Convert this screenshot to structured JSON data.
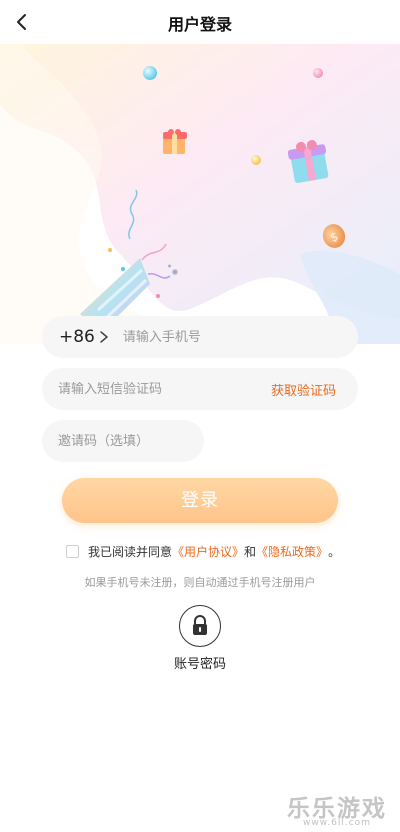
{
  "header": {
    "back_icon": "chevron-left-icon",
    "title": "用户登录"
  },
  "form": {
    "country_code": "+86",
    "phone_placeholder": "请输入手机号",
    "sms_placeholder": "请输入短信验证码",
    "get_code_label": "获取验证码",
    "invite_placeholder": "邀请码（选填）",
    "login_label": "登录"
  },
  "agreement": {
    "prefix": "我已阅读并同意",
    "user_agreement": "《用户协议》",
    "and": "和",
    "privacy_policy": "《隐私政策》",
    "suffix": "。"
  },
  "hint": "如果手机号未注册，则自动通过手机号注册用户",
  "alt_login": {
    "icon": "lock-icon",
    "label": "账号密码"
  },
  "watermark": {
    "text": "乐乐游戏",
    "url": "www.6ll.com"
  },
  "colors": {
    "accent": "#ea6a1f",
    "button_gradient_start": "#ffd7a4",
    "button_gradient_end": "#ffc48a",
    "field_bg": "#f6f6f6"
  }
}
